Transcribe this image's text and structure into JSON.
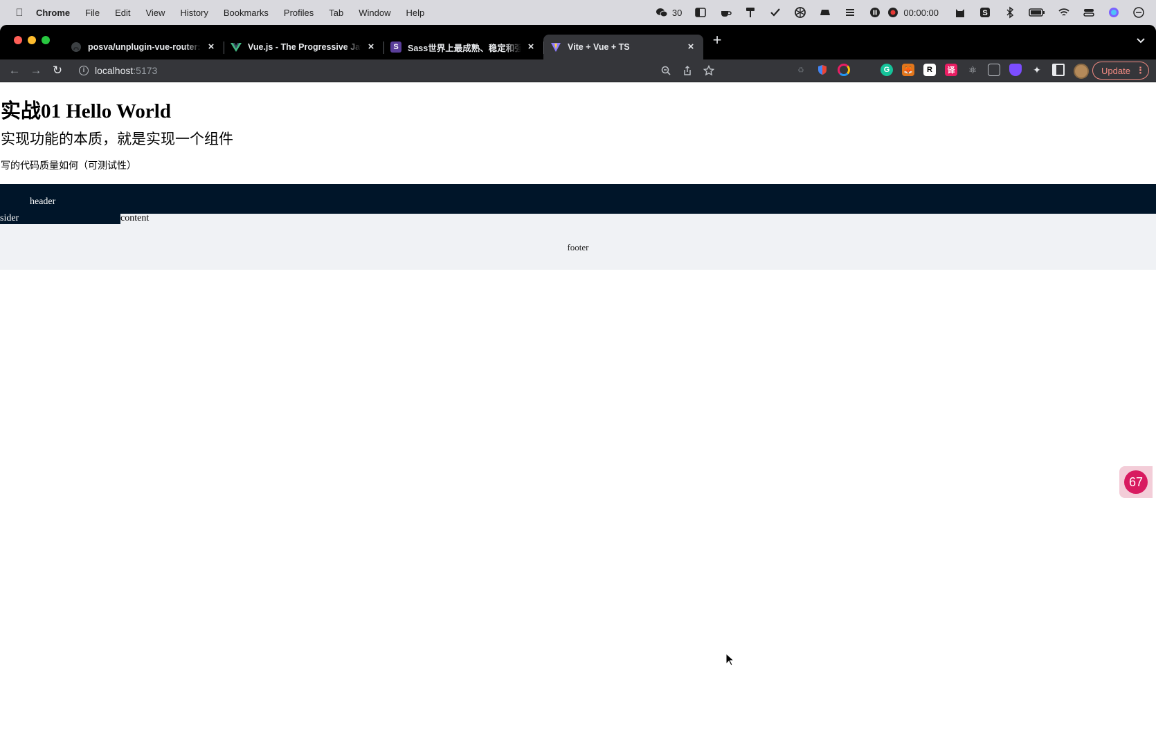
{
  "menubar": {
    "app": "Chrome",
    "items": [
      "File",
      "Edit",
      "View",
      "History",
      "Bookmarks",
      "Profiles",
      "Tab",
      "Window",
      "Help"
    ],
    "wechat_count": "30",
    "timer": "00:00:00"
  },
  "tabs": [
    {
      "title": "posva/unplugin-vue-router: Ne",
      "favicon": "github-icon"
    },
    {
      "title": "Vue.js - The Progressive JavaS",
      "favicon": "vue-icon"
    },
    {
      "title": "Sass世界上最成熟、稳定和强大",
      "favicon": "sass-icon"
    },
    {
      "title": "Vite + Vue + TS",
      "favicon": "vite-icon",
      "active": true
    }
  ],
  "address": {
    "host": "localhost",
    "port": ":5173"
  },
  "toolbar": {
    "update_label": "Update"
  },
  "page": {
    "h1": "实战01 Hello World",
    "h2": "实现功能的本质，就是实现一个组件",
    "p": "写的代码质量如何（可测试性）",
    "layout": {
      "header": "header",
      "sider": "sider",
      "content": "content",
      "footer": "footer"
    }
  },
  "badge": {
    "count": "67"
  },
  "colors": {
    "layout_dark": "#001529",
    "layout_light": "#f0f2f5",
    "update_accent": "#f28b82",
    "badge": "#d81b60"
  }
}
